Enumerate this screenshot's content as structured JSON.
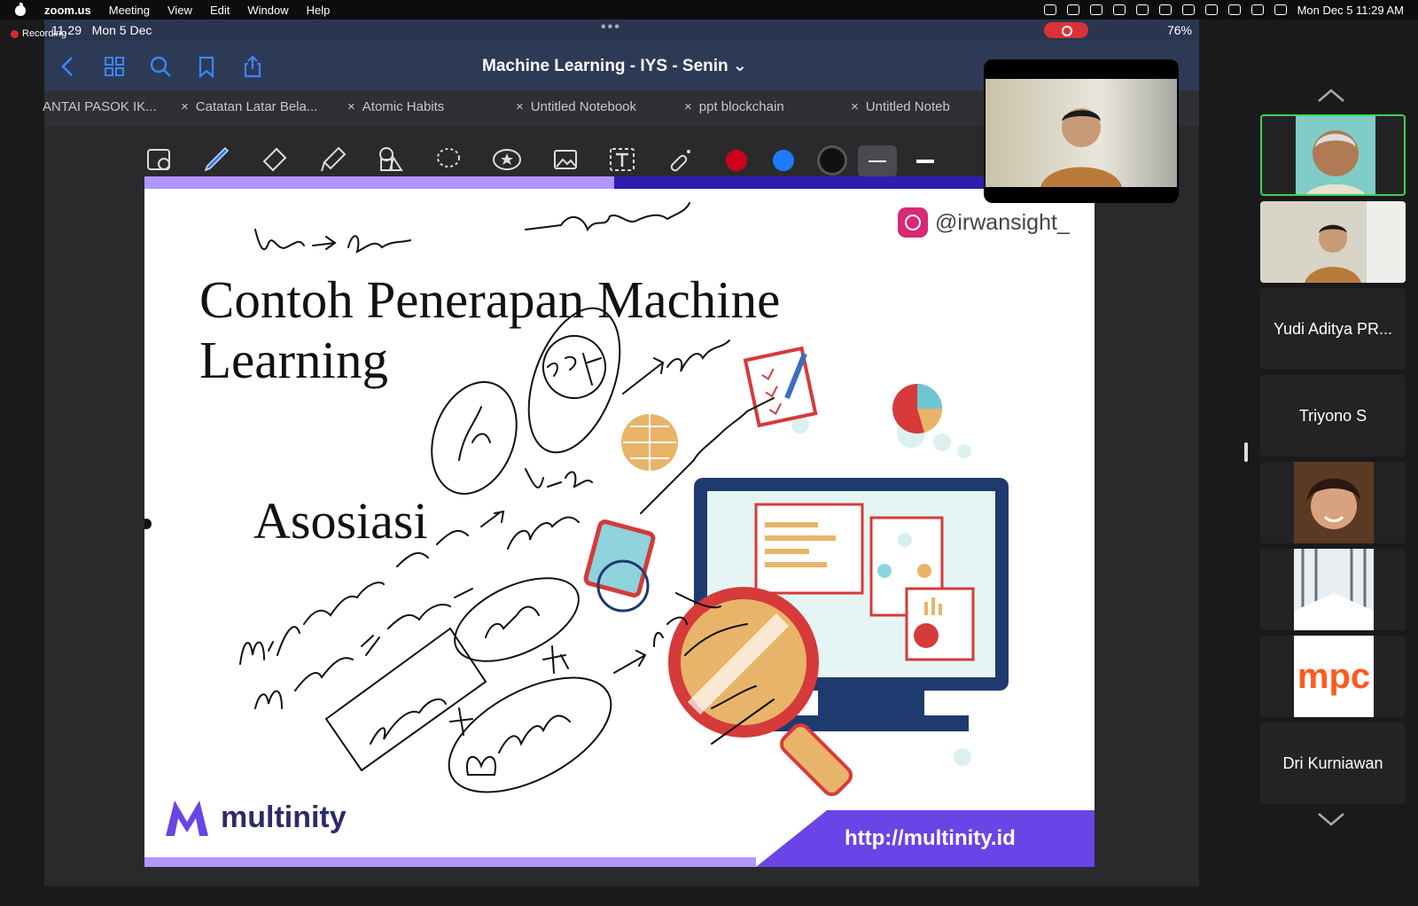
{
  "menubar": {
    "app": "zoom.us",
    "menus": [
      "Meeting",
      "View",
      "Edit",
      "Window",
      "Help"
    ],
    "datetime": "Mon Dec 5  11:29 AM"
  },
  "recording_label": "Recording",
  "ipad": {
    "time": "11.29",
    "date": "Mon 5 Dec",
    "battery": "76%",
    "notebook_title": "Machine Learning - IYS - Senin",
    "tabs": [
      "ANTAI PASOK IK...",
      "Catatan Latar Bela...",
      "Atomic Habits",
      "Untitled Notebook",
      "ppt blockchain",
      "Untitled Noteb"
    ],
    "colors": {
      "red": "#d0021b",
      "blue": "#1e7bff",
      "black": "#111111"
    }
  },
  "slide": {
    "instagram": "@irwansight_",
    "title_line1": "Contoh Penerapan Machine",
    "title_line2": "Learning",
    "subtitle": "Asosiasi",
    "brand": "multinity",
    "url": "http://multinity.id"
  },
  "participants": [
    {
      "name": "",
      "type": "video"
    },
    {
      "name": "",
      "type": "video"
    },
    {
      "name": "Yudi Aditya PR...",
      "type": "name"
    },
    {
      "name": "Triyono S",
      "type": "name"
    },
    {
      "name": "",
      "type": "video"
    },
    {
      "name": "",
      "type": "video"
    },
    {
      "name": "",
      "type": "video"
    },
    {
      "name": "Dri Kurniawan",
      "type": "name"
    }
  ],
  "brand_tile_text": "mpc"
}
